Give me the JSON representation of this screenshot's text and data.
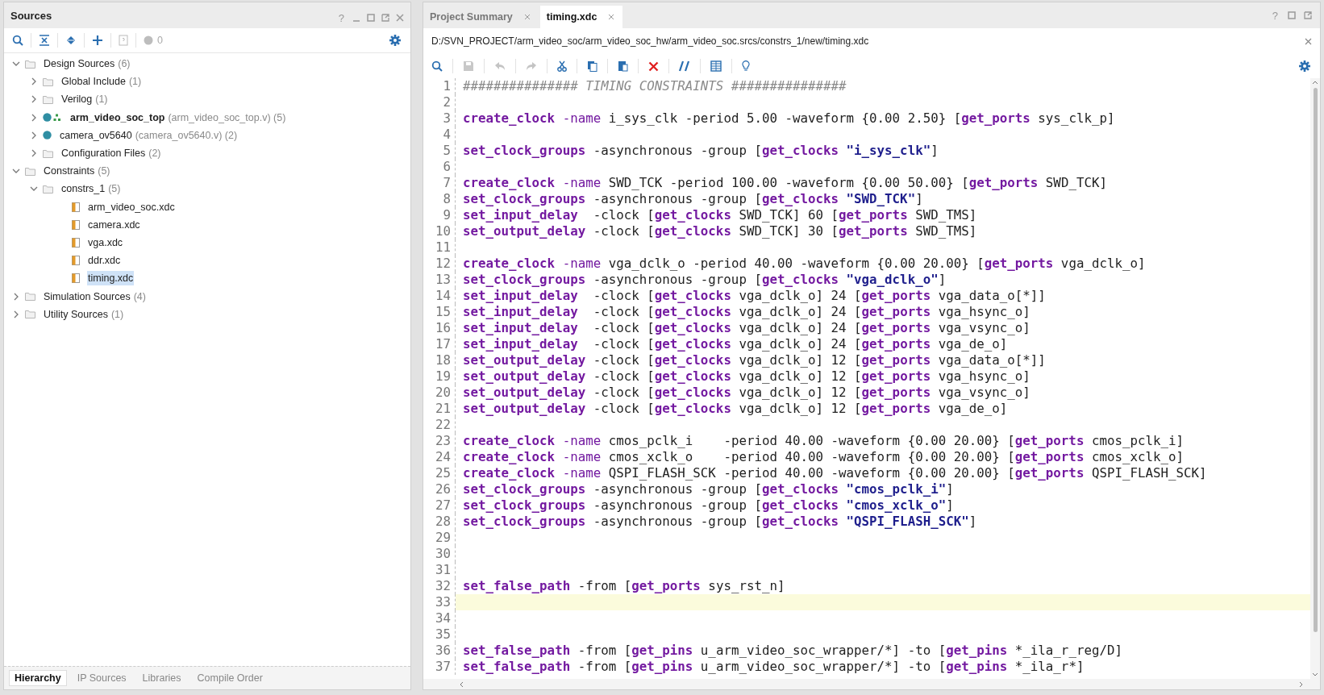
{
  "sources_panel": {
    "title": "Sources",
    "help": "?",
    "issue_count": "0",
    "tree": [
      {
        "label": "Design Sources",
        "suffix": "(6)",
        "kind": "folder",
        "expanded": true,
        "selected": false,
        "children": [
          {
            "label": "Global Include",
            "suffix": "(1)",
            "kind": "folder",
            "expanded": false,
            "selected": false
          },
          {
            "label": "Verilog",
            "suffix": "(1)",
            "kind": "folder",
            "expanded": false,
            "selected": false
          },
          {
            "label": "arm_video_soc_top",
            "suffix": "(arm_video_soc_top.v) (5)",
            "kind": "top",
            "expanded": false,
            "selected": false
          },
          {
            "label": "camera_ov5640",
            "suffix": "(camera_ov5640.v) (2)",
            "kind": "module",
            "expanded": false,
            "selected": false
          },
          {
            "label": "Configuration Files",
            "suffix": "(2)",
            "kind": "folder",
            "expanded": false,
            "selected": false
          }
        ]
      },
      {
        "label": "Constraints",
        "suffix": "(5)",
        "kind": "folder",
        "expanded": true,
        "selected": false,
        "children": [
          {
            "label": "constrs_1",
            "suffix": "(5)",
            "kind": "folder",
            "expanded": true,
            "selected": false,
            "children": [
              {
                "label": "arm_video_soc.xdc",
                "kind": "file",
                "selected": false
              },
              {
                "label": "camera.xdc",
                "kind": "file",
                "selected": false
              },
              {
                "label": "vga.xdc",
                "kind": "file",
                "selected": false
              },
              {
                "label": "ddr.xdc",
                "kind": "file",
                "selected": false
              },
              {
                "label": "timing.xdc",
                "kind": "file",
                "selected": true
              }
            ]
          }
        ]
      },
      {
        "label": "Simulation Sources",
        "suffix": "(4)",
        "kind": "folder",
        "expanded": false,
        "selected": false
      },
      {
        "label": "Utility Sources",
        "suffix": "(1)",
        "kind": "folder",
        "expanded": false,
        "selected": false
      }
    ],
    "bottom_tabs": [
      {
        "label": "Hierarchy",
        "selected": true
      },
      {
        "label": "IP Sources",
        "selected": false
      },
      {
        "label": "Libraries",
        "selected": false
      },
      {
        "label": "Compile Order",
        "selected": false
      }
    ]
  },
  "editor": {
    "tabs": [
      {
        "label": "Project Summary",
        "selected": false
      },
      {
        "label": "timing.xdc",
        "selected": true
      }
    ],
    "help": "?",
    "path": "D:/SVN_PROJECT/arm_video_soc/arm_video_soc_hw/arm_video_soc.srcs/constrs_1/new/timing.xdc",
    "lines": [
      {
        "n": "1",
        "current": false,
        "segs": [
          {
            "kind": "comment",
            "text": "############### TIMING CONSTRAINTS ###############"
          }
        ]
      },
      {
        "n": "2",
        "current": false
      },
      {
        "n": "3",
        "current": false,
        "segs": [
          {
            "kind": "keyword",
            "text": "create_clock"
          },
          {
            "kind": "option",
            "text": " -name"
          },
          {
            "kind": "plain",
            "text": " i_sys_clk -period 5.00 -waveform {0.00 2.50} ["
          },
          {
            "kind": "keyword",
            "text": "get_ports"
          },
          {
            "kind": "plain",
            "text": " sys_clk_p]"
          }
        ]
      },
      {
        "n": "4",
        "current": false
      },
      {
        "n": "5",
        "current": false,
        "segs": [
          {
            "kind": "keyword",
            "text": "set_clock_groups"
          },
          {
            "kind": "plain",
            "text": " -asynchronous -group ["
          },
          {
            "kind": "keyword",
            "text": "get_clocks"
          },
          {
            "kind": "string",
            "text": " \"i_sys_clk\""
          },
          {
            "kind": "plain",
            "text": "]"
          }
        ]
      },
      {
        "n": "6",
        "current": false
      },
      {
        "n": "7",
        "current": false,
        "segs": [
          {
            "kind": "keyword",
            "text": "create_clock"
          },
          {
            "kind": "option",
            "text": " -name"
          },
          {
            "kind": "plain",
            "text": " SWD_TCK -period 100.00 -waveform {0.00 50.00} ["
          },
          {
            "kind": "keyword",
            "text": "get_ports"
          },
          {
            "kind": "plain",
            "text": " SWD_TCK]"
          }
        ]
      },
      {
        "n": "8",
        "current": false,
        "segs": [
          {
            "kind": "keyword",
            "text": "set_clock_groups"
          },
          {
            "kind": "plain",
            "text": " -asynchronous -group ["
          },
          {
            "kind": "keyword",
            "text": "get_clocks"
          },
          {
            "kind": "string",
            "text": " \"SWD_TCK\""
          },
          {
            "kind": "plain",
            "text": "]"
          }
        ]
      },
      {
        "n": "9",
        "current": false,
        "segs": [
          {
            "kind": "keyword",
            "text": "set_input_delay"
          },
          {
            "kind": "plain",
            "text": "  -clock ["
          },
          {
            "kind": "keyword",
            "text": "get_clocks"
          },
          {
            "kind": "plain",
            "text": " SWD_TCK] 60 ["
          },
          {
            "kind": "keyword",
            "text": "get_ports"
          },
          {
            "kind": "plain",
            "text": " SWD_TMS]"
          }
        ]
      },
      {
        "n": "10",
        "current": false,
        "segs": [
          {
            "kind": "keyword",
            "text": "set_output_delay"
          },
          {
            "kind": "plain",
            "text": " -clock ["
          },
          {
            "kind": "keyword",
            "text": "get_clocks"
          },
          {
            "kind": "plain",
            "text": " SWD_TCK] 30 ["
          },
          {
            "kind": "keyword",
            "text": "get_ports"
          },
          {
            "kind": "plain",
            "text": " SWD_TMS]"
          }
        ]
      },
      {
        "n": "11",
        "current": false
      },
      {
        "n": "12",
        "current": false,
        "segs": [
          {
            "kind": "keyword",
            "text": "create_clock"
          },
          {
            "kind": "option",
            "text": " -name"
          },
          {
            "kind": "plain",
            "text": " vga_dclk_o -period 40.00 -waveform {0.00 20.00} ["
          },
          {
            "kind": "keyword",
            "text": "get_ports"
          },
          {
            "kind": "plain",
            "text": " vga_dclk_o]"
          }
        ]
      },
      {
        "n": "13",
        "current": false,
        "segs": [
          {
            "kind": "keyword",
            "text": "set_clock_groups"
          },
          {
            "kind": "plain",
            "text": " -asynchronous -group ["
          },
          {
            "kind": "keyword",
            "text": "get_clocks"
          },
          {
            "kind": "string",
            "text": " \"vga_dclk_o\""
          },
          {
            "kind": "plain",
            "text": "]"
          }
        ]
      },
      {
        "n": "14",
        "current": false,
        "segs": [
          {
            "kind": "keyword",
            "text": "set_input_delay"
          },
          {
            "kind": "plain",
            "text": "  -clock ["
          },
          {
            "kind": "keyword",
            "text": "get_clocks"
          },
          {
            "kind": "plain",
            "text": " vga_dclk_o] 24 ["
          },
          {
            "kind": "keyword",
            "text": "get_ports"
          },
          {
            "kind": "plain",
            "text": " vga_data_o[*]]"
          }
        ]
      },
      {
        "n": "15",
        "current": false,
        "segs": [
          {
            "kind": "keyword",
            "text": "set_input_delay"
          },
          {
            "kind": "plain",
            "text": "  -clock ["
          },
          {
            "kind": "keyword",
            "text": "get_clocks"
          },
          {
            "kind": "plain",
            "text": " vga_dclk_o] 24 ["
          },
          {
            "kind": "keyword",
            "text": "get_ports"
          },
          {
            "kind": "plain",
            "text": " vga_hsync_o]"
          }
        ]
      },
      {
        "n": "16",
        "current": false,
        "segs": [
          {
            "kind": "keyword",
            "text": "set_input_delay"
          },
          {
            "kind": "plain",
            "text": "  -clock ["
          },
          {
            "kind": "keyword",
            "text": "get_clocks"
          },
          {
            "kind": "plain",
            "text": " vga_dclk_o] 24 ["
          },
          {
            "kind": "keyword",
            "text": "get_ports"
          },
          {
            "kind": "plain",
            "text": " vga_vsync_o]"
          }
        ]
      },
      {
        "n": "17",
        "current": false,
        "segs": [
          {
            "kind": "keyword",
            "text": "set_input_delay"
          },
          {
            "kind": "plain",
            "text": "  -clock ["
          },
          {
            "kind": "keyword",
            "text": "get_clocks"
          },
          {
            "kind": "plain",
            "text": " vga_dclk_o] 24 ["
          },
          {
            "kind": "keyword",
            "text": "get_ports"
          },
          {
            "kind": "plain",
            "text": " vga_de_o]"
          }
        ]
      },
      {
        "n": "18",
        "current": false,
        "segs": [
          {
            "kind": "keyword",
            "text": "set_output_delay"
          },
          {
            "kind": "plain",
            "text": " -clock ["
          },
          {
            "kind": "keyword",
            "text": "get_clocks"
          },
          {
            "kind": "plain",
            "text": " vga_dclk_o] 12 ["
          },
          {
            "kind": "keyword",
            "text": "get_ports"
          },
          {
            "kind": "plain",
            "text": " vga_data_o[*]]"
          }
        ]
      },
      {
        "n": "19",
        "current": false,
        "segs": [
          {
            "kind": "keyword",
            "text": "set_output_delay"
          },
          {
            "kind": "plain",
            "text": " -clock ["
          },
          {
            "kind": "keyword",
            "text": "get_clocks"
          },
          {
            "kind": "plain",
            "text": " vga_dclk_o] 12 ["
          },
          {
            "kind": "keyword",
            "text": "get_ports"
          },
          {
            "kind": "plain",
            "text": " vga_hsync_o]"
          }
        ]
      },
      {
        "n": "20",
        "current": false,
        "segs": [
          {
            "kind": "keyword",
            "text": "set_output_delay"
          },
          {
            "kind": "plain",
            "text": " -clock ["
          },
          {
            "kind": "keyword",
            "text": "get_clocks"
          },
          {
            "kind": "plain",
            "text": " vga_dclk_o] 12 ["
          },
          {
            "kind": "keyword",
            "text": "get_ports"
          },
          {
            "kind": "plain",
            "text": " vga_vsync_o]"
          }
        ]
      },
      {
        "n": "21",
        "current": false,
        "segs": [
          {
            "kind": "keyword",
            "text": "set_output_delay"
          },
          {
            "kind": "plain",
            "text": " -clock ["
          },
          {
            "kind": "keyword",
            "text": "get_clocks"
          },
          {
            "kind": "plain",
            "text": " vga_dclk_o] 12 ["
          },
          {
            "kind": "keyword",
            "text": "get_ports"
          },
          {
            "kind": "plain",
            "text": " vga_de_o]"
          }
        ]
      },
      {
        "n": "22",
        "current": false
      },
      {
        "n": "23",
        "current": false,
        "segs": [
          {
            "kind": "keyword",
            "text": "create_clock"
          },
          {
            "kind": "option",
            "text": " -name"
          },
          {
            "kind": "plain",
            "text": " cmos_pclk_i    -period 40.00 -waveform {0.00 20.00} ["
          },
          {
            "kind": "keyword",
            "text": "get_ports"
          },
          {
            "kind": "plain",
            "text": " cmos_pclk_i]"
          }
        ]
      },
      {
        "n": "24",
        "current": false,
        "segs": [
          {
            "kind": "keyword",
            "text": "create_clock"
          },
          {
            "kind": "option",
            "text": " -name"
          },
          {
            "kind": "plain",
            "text": " cmos_xclk_o    -period 40.00 -waveform {0.00 20.00} ["
          },
          {
            "kind": "keyword",
            "text": "get_ports"
          },
          {
            "kind": "plain",
            "text": " cmos_xclk_o]"
          }
        ]
      },
      {
        "n": "25",
        "current": false,
        "segs": [
          {
            "kind": "keyword",
            "text": "create_clock"
          },
          {
            "kind": "option",
            "text": " -name"
          },
          {
            "kind": "plain",
            "text": " QSPI_FLASH_SCK -period 40.00 -waveform {0.00 20.00} ["
          },
          {
            "kind": "keyword",
            "text": "get_ports"
          },
          {
            "kind": "plain",
            "text": " QSPI_FLASH_SCK]"
          }
        ]
      },
      {
        "n": "26",
        "current": false,
        "segs": [
          {
            "kind": "keyword",
            "text": "set_clock_groups"
          },
          {
            "kind": "plain",
            "text": " -asynchronous -group ["
          },
          {
            "kind": "keyword",
            "text": "get_clocks"
          },
          {
            "kind": "string",
            "text": " \"cmos_pclk_i\""
          },
          {
            "kind": "plain",
            "text": "]"
          }
        ]
      },
      {
        "n": "27",
        "current": false,
        "segs": [
          {
            "kind": "keyword",
            "text": "set_clock_groups"
          },
          {
            "kind": "plain",
            "text": " -asynchronous -group ["
          },
          {
            "kind": "keyword",
            "text": "get_clocks"
          },
          {
            "kind": "string",
            "text": " \"cmos_xclk_o\""
          },
          {
            "kind": "plain",
            "text": "]"
          }
        ]
      },
      {
        "n": "28",
        "current": false,
        "segs": [
          {
            "kind": "keyword",
            "text": "set_clock_groups"
          },
          {
            "kind": "plain",
            "text": " -asynchronous -group ["
          },
          {
            "kind": "keyword",
            "text": "get_clocks"
          },
          {
            "kind": "string",
            "text": " \"QSPI_FLASH_SCK\""
          },
          {
            "kind": "plain",
            "text": "]"
          }
        ]
      },
      {
        "n": "29",
        "current": false
      },
      {
        "n": "30",
        "current": false
      },
      {
        "n": "31",
        "current": false
      },
      {
        "n": "32",
        "current": false,
        "segs": [
          {
            "kind": "keyword",
            "text": "set_false_path"
          },
          {
            "kind": "plain",
            "text": " -from ["
          },
          {
            "kind": "keyword",
            "text": "get_ports"
          },
          {
            "kind": "plain",
            "text": " sys_rst_n]"
          }
        ]
      },
      {
        "n": "33",
        "current": true
      },
      {
        "n": "34",
        "current": false
      },
      {
        "n": "35",
        "current": false
      },
      {
        "n": "36",
        "current": false,
        "segs": [
          {
            "kind": "keyword",
            "text": "set_false_path"
          },
          {
            "kind": "plain",
            "text": " -from ["
          },
          {
            "kind": "keyword",
            "text": "get_pins"
          },
          {
            "kind": "plain",
            "text": " u_arm_video_soc_wrapper/*] -to ["
          },
          {
            "kind": "keyword",
            "text": "get_pins"
          },
          {
            "kind": "plain",
            "text": " *_ila_r_reg/D]"
          }
        ]
      },
      {
        "n": "37",
        "current": false,
        "segs": [
          {
            "kind": "keyword",
            "text": "set_false_path"
          },
          {
            "kind": "plain",
            "text": " -from ["
          },
          {
            "kind": "keyword",
            "text": "get_pins"
          },
          {
            "kind": "plain",
            "text": " u_arm_video_soc_wrapper/*] -to ["
          },
          {
            "kind": "keyword",
            "text": "get_pins"
          },
          {
            "kind": "plain",
            "text": " *_ila_r*]"
          }
        ]
      }
    ]
  }
}
